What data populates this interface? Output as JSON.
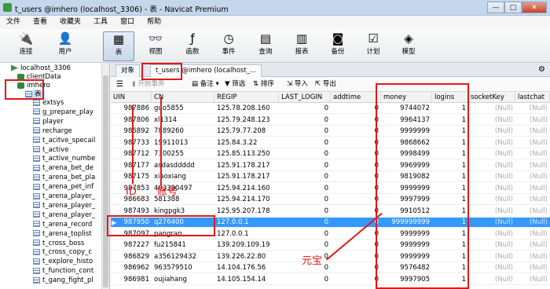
{
  "window": {
    "title": "t_users @imhero (localhost_3306) - 表 - Navicat Premium",
    "controls": [
      "—",
      "□",
      "✕"
    ]
  },
  "menu": [
    "文件",
    "查看",
    "收藏夹",
    "工具",
    "窗口",
    "帮助"
  ],
  "toolbar": [
    {
      "label": "连接",
      "icon": "plug-icon",
      "glyph": "🔌"
    },
    {
      "label": "用户",
      "icon": "user-icon",
      "glyph": "👤"
    },
    {
      "label": "表",
      "icon": "table-icon",
      "glyph": "▦"
    },
    {
      "label": "视图",
      "icon": "view-icon",
      "glyph": "👓"
    },
    {
      "label": "函数",
      "icon": "function-icon",
      "glyph": "ƒ"
    },
    {
      "label": "事件",
      "icon": "event-icon",
      "glyph": "◷"
    },
    {
      "label": "查询",
      "icon": "query-icon",
      "glyph": "▤"
    },
    {
      "label": "报表",
      "icon": "report-icon",
      "glyph": "▥"
    },
    {
      "label": "备份",
      "icon": "backup-icon",
      "glyph": "◙"
    },
    {
      "label": "计划",
      "icon": "schedule-icon",
      "glyph": "☑"
    },
    {
      "label": "模型",
      "icon": "model-icon",
      "glyph": "◈"
    }
  ],
  "tree": {
    "connection": "localhost_3306",
    "databases": [
      "clientData",
      "imhero"
    ],
    "tables_folder": "表",
    "tables": [
      "extsys",
      "g_prepare_play",
      "player",
      "recharge",
      "t_acitve_specail",
      "t_active",
      "t_active_numbe",
      "t_arena_bet_de",
      "t_arena_bet_pla",
      "t_arena_pet_inf",
      "t_arena_player_",
      "t_arena_player_",
      "t_arena_player_",
      "t_arena_record",
      "t_arena_toplist",
      "t_cross_boss",
      "t_cross_copy_c",
      "t_explore_histo",
      "t_function_cont",
      "t_gang_fight_pl"
    ]
  },
  "tabs": {
    "objects": "对象",
    "table_tab": "t_users @imhero (localhost_..."
  },
  "subbar": {
    "menu_glyph": "☰",
    "begin_txn": "开始事务",
    "memo": "备注",
    "filter": "筛选",
    "sort": "排序",
    "import": "导入",
    "export": "导出"
  },
  "grid": {
    "columns": [
      "UIN",
      "CN",
      "REGIP",
      "LAST_LOGIN",
      "addtime",
      "money",
      "logins",
      "socketKey",
      "lastchat"
    ],
    "null_text": "(Null)",
    "selected_marker": "▶",
    "rows": [
      [
        "987886",
        "guo5855",
        "125.78.208.160",
        "0",
        "0",
        "9744072",
        "1"
      ],
      [
        "987806",
        "xl1314",
        "125.79.248.123",
        "0",
        "0",
        "9964137",
        "1"
      ],
      [
        "986892",
        "7889260",
        "125.79.77.208",
        "0",
        "0",
        "9999999",
        "1"
      ],
      [
        "987733",
        "19911013",
        "125.84.3.22",
        "0",
        "0",
        "9868662",
        "1"
      ],
      [
        "987712",
        "7300255",
        "125.85.113.250",
        "0",
        "0",
        "9998499",
        "1"
      ],
      [
        "987177",
        "asdasddddd",
        "125.91.178.217",
        "0",
        "0",
        "9969999",
        "1"
      ],
      [
        "987175",
        "xiaoxiang",
        "125.91.178.217",
        "0",
        "0",
        "9819082",
        "1"
      ],
      [
        "987853",
        "403390497",
        "125.94.214.160",
        "0",
        "0",
        "9999999",
        "1"
      ],
      [
        "986683",
        "581388",
        "125.94.214.170",
        "0",
        "0",
        "9997999",
        "1"
      ],
      [
        "987493",
        "kingpgk3",
        "125.95.207.178",
        "0",
        "0",
        "9910512",
        "1"
      ],
      [
        "987950",
        "q276400",
        "127.0.0.1",
        "0",
        "0",
        "999999999",
        "1"
      ],
      [
        "987097",
        "pangran",
        "127.0.0.1",
        "0",
        "0",
        "9999999",
        "1"
      ],
      [
        "987227",
        "fu215841",
        "139.209.109.19",
        "0",
        "0",
        "9999999",
        "1"
      ],
      [
        "986829",
        "a356129432",
        "139.226.22.80",
        "0",
        "0",
        "9999999",
        "1"
      ],
      [
        "986962",
        "963579510",
        "14.104.176.56",
        "0",
        "0",
        "9576482",
        "1"
      ],
      [
        "986981",
        "oujiahang",
        "14.105.154.14",
        "0",
        "0",
        "9997905",
        "1"
      ]
    ],
    "selected_row": 10
  },
  "annotations": {
    "id_label": "ID",
    "account_label": "账号",
    "currency_label": "元宝",
    "color": "#e0191a"
  }
}
